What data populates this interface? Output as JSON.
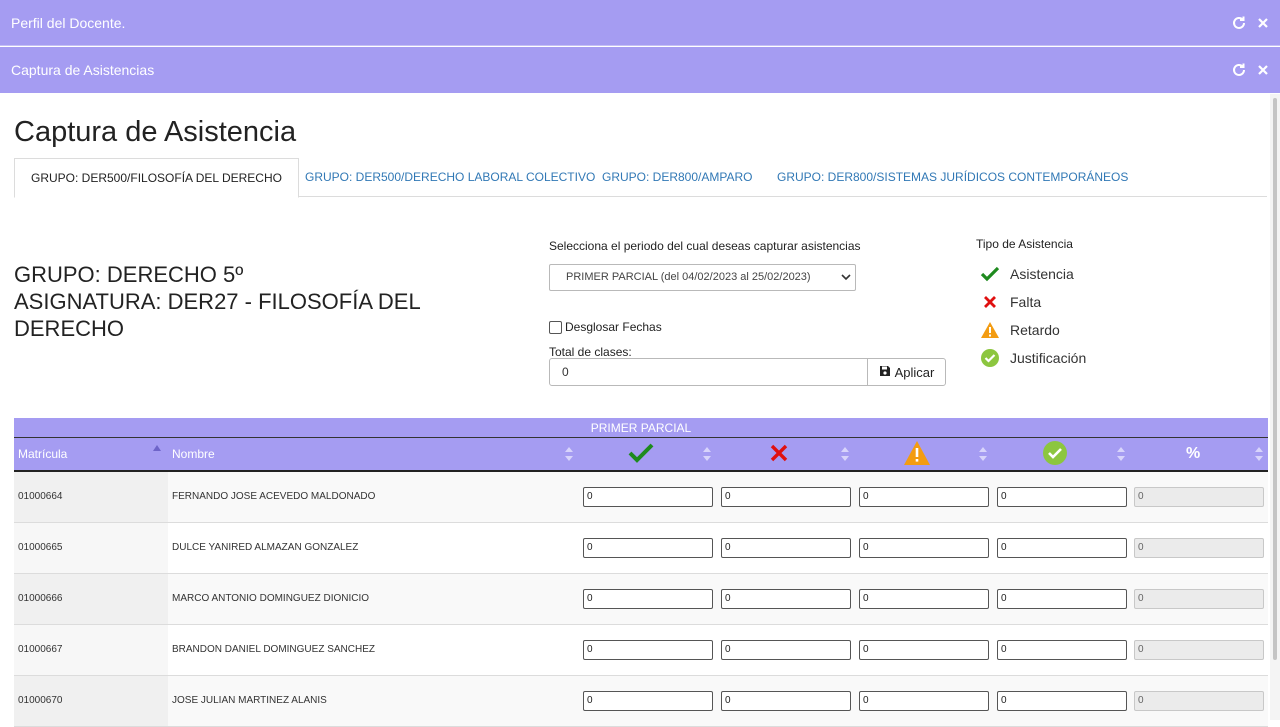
{
  "windows": {
    "outer_title": "Perfil del Docente.",
    "inner_title": "Captura de Asistencias"
  },
  "page": {
    "title": "Captura de Asistencia",
    "tabs": [
      {
        "label": "GRUPO: DER500/FILOSOFÍA DEL DERECHO",
        "active": true
      },
      {
        "label": "GRUPO: DER500/DERECHO LABORAL COLECTIVO",
        "active": false
      },
      {
        "label": "GRUPO: DER800/AMPARO",
        "active": false
      },
      {
        "label": "GRUPO: DER800/SISTEMAS JURÍDICOS CONTEMPORÁNEOS",
        "active": false
      }
    ]
  },
  "group": {
    "line1": "GRUPO: DERECHO 5º",
    "line2": "ASIGNATURA: DER27 - FILOSOFÍA DEL",
    "line3": "DERECHO"
  },
  "form": {
    "periodo_label": "Selecciona el periodo del cual deseas capturar asistencias",
    "periodo_selected": "PRIMER PARCIAL (del 04/02/2023 al 25/02/2023)",
    "desglosar_label": "Desglosar Fechas",
    "desglosar_checked": false,
    "total_label": "Total de clases:",
    "total_value": "0",
    "aplicar_label": "Aplicar"
  },
  "legend": {
    "title": "Tipo de Asistencia",
    "items": [
      {
        "label": "Asistencia",
        "icon": "check-icon",
        "color": "#1e8a1e"
      },
      {
        "label": "Falta",
        "icon": "x-icon",
        "color": "#e01010"
      },
      {
        "label": "Retardo",
        "icon": "warning-icon",
        "color": "#f39c12"
      },
      {
        "label": "Justificación",
        "icon": "check-circle-icon",
        "color": "#8cc63f"
      }
    ]
  },
  "table": {
    "period_header": "PRIMER PARCIAL",
    "columns": {
      "matricula": "Matrícula",
      "nombre": "Nombre",
      "percent": "%"
    },
    "rows": [
      {
        "matricula": "01000664",
        "nombre": "FERNANDO JOSE ACEVEDO MALDONADO",
        "asistencia": "0",
        "falta": "0",
        "retardo": "0",
        "justificacion": "0",
        "porcentaje": "0"
      },
      {
        "matricula": "01000665",
        "nombre": "DULCE YANIRED ALMAZAN GONZALEZ",
        "asistencia": "0",
        "falta": "0",
        "retardo": "0",
        "justificacion": "0",
        "porcentaje": "0"
      },
      {
        "matricula": "01000666",
        "nombre": "MARCO ANTONIO DOMINGUEZ DIONICIO",
        "asistencia": "0",
        "falta": "0",
        "retardo": "0",
        "justificacion": "0",
        "porcentaje": "0"
      },
      {
        "matricula": "01000667",
        "nombre": "BRANDON DANIEL DOMINGUEZ SANCHEZ",
        "asistencia": "0",
        "falta": "0",
        "retardo": "0",
        "justificacion": "0",
        "porcentaje": "0"
      },
      {
        "matricula": "01000670",
        "nombre": "JOSE JULIAN MARTINEZ ALANIS",
        "asistencia": "0",
        "falta": "0",
        "retardo": "0",
        "justificacion": "0",
        "porcentaje": "0"
      }
    ]
  },
  "colors": {
    "accent": "#a59cf2",
    "link": "#3178b5"
  }
}
